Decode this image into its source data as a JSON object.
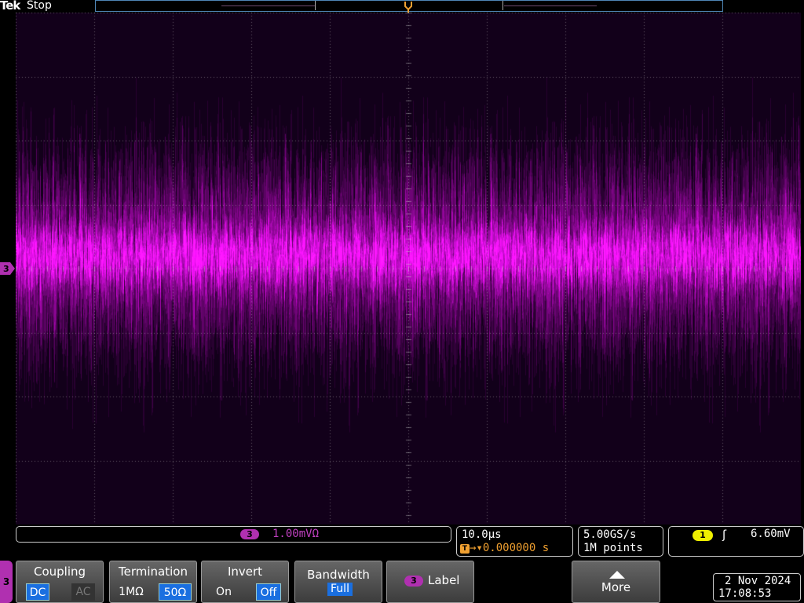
{
  "brand": "Tek",
  "run_status": "Stop",
  "trigger_marker": "T",
  "channel": {
    "number": "3",
    "scale": "1.00mVΩ",
    "color": "#ff10ff"
  },
  "horizontal": {
    "scale": "10.0µs",
    "trigger_symbol": "T",
    "delay": "→▾0.000000 s"
  },
  "acquisition": {
    "sample_rate": "5.00GS/s",
    "record_length": "1M points"
  },
  "trigger": {
    "source": "1",
    "slope_symbol": "ʃ",
    "level": "6.60mV"
  },
  "menu": {
    "coupling": {
      "title": "Coupling",
      "options": [
        "DC",
        "AC"
      ],
      "selected": "DC"
    },
    "termination": {
      "title": "Termination",
      "options": [
        "1MΩ",
        "50Ω"
      ],
      "selected": "50Ω"
    },
    "invert": {
      "title": "Invert",
      "options": [
        "On",
        "Off"
      ],
      "selected": "Off"
    },
    "bandwidth": {
      "title": "Bandwidth",
      "value": "Full"
    },
    "label": {
      "badge": "3",
      "title": "Label"
    },
    "more": {
      "title": "More"
    }
  },
  "datetime": {
    "date": "2 Nov 2024",
    "time": "17:08:53"
  }
}
